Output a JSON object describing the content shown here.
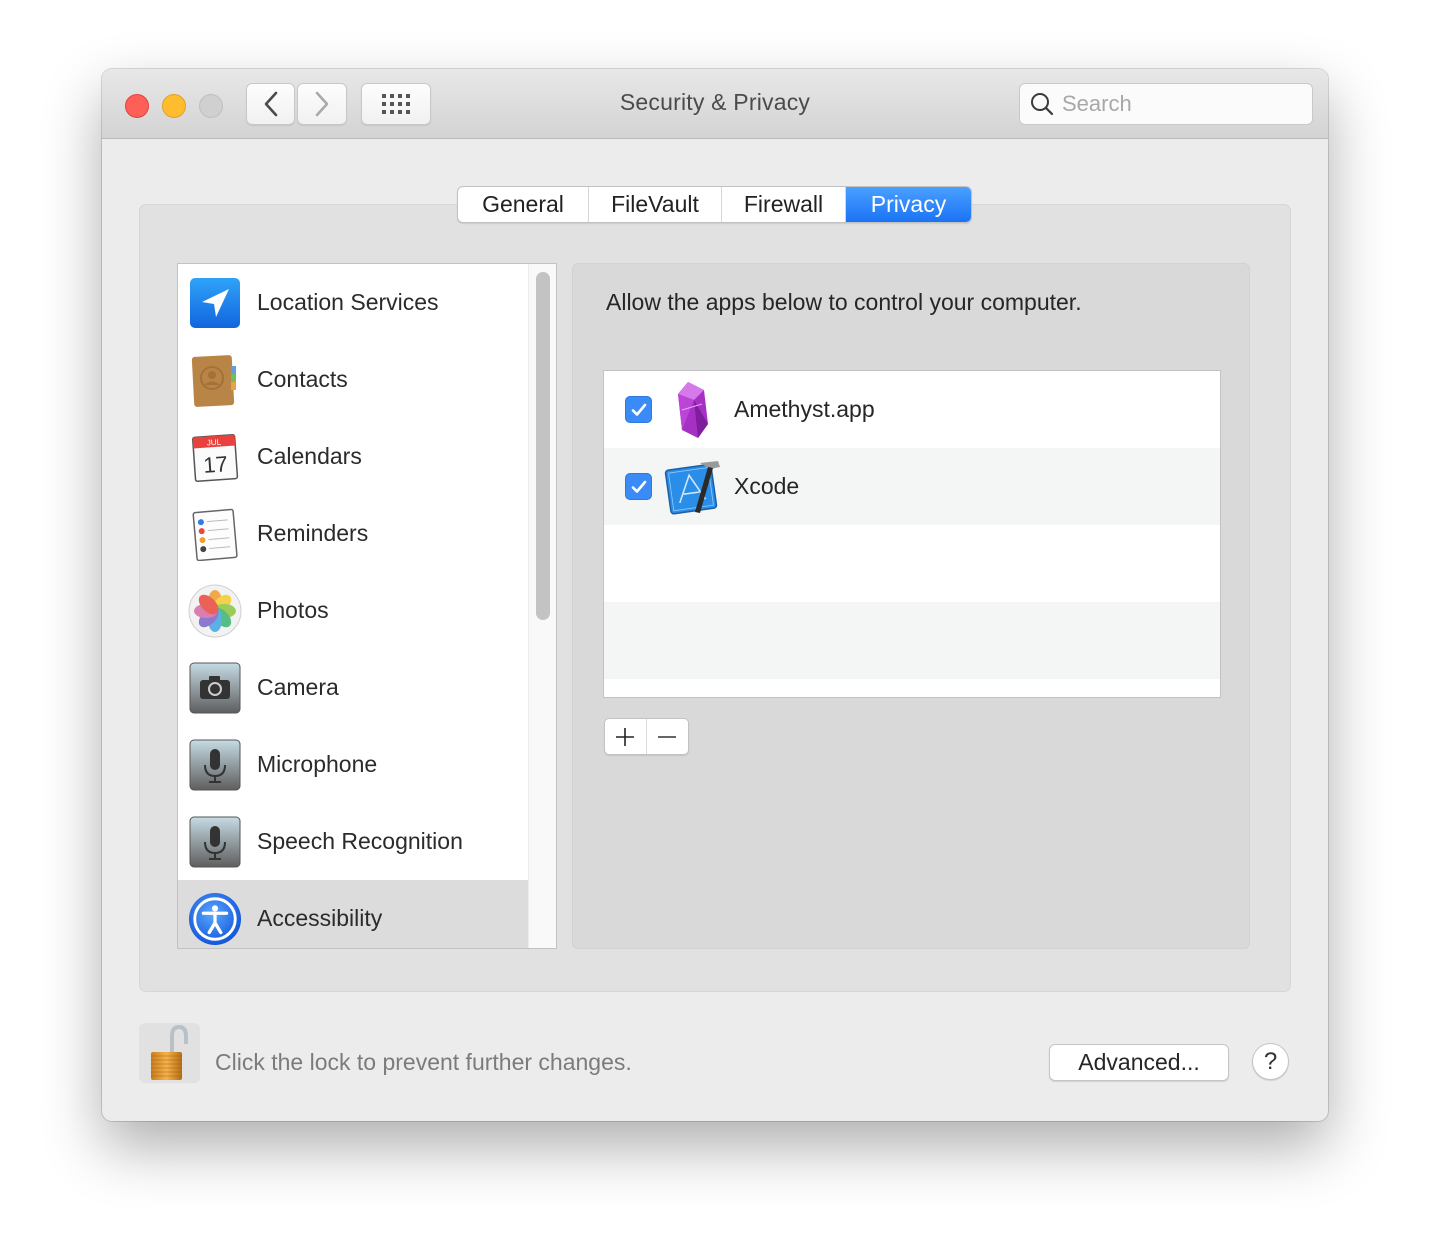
{
  "window": {
    "title": "Security & Privacy",
    "traffic_lights": [
      "close",
      "minimize",
      "zoom"
    ]
  },
  "toolbar": {
    "back_icon": "chevron-left-icon",
    "forward_icon": "chevron-right-icon",
    "show_all_icon": "grid-icon",
    "search": {
      "placeholder": "Search",
      "value": ""
    }
  },
  "tabs": [
    {
      "label": "General",
      "active": false
    },
    {
      "label": "FileVault",
      "active": false
    },
    {
      "label": "Firewall",
      "active": false
    },
    {
      "label": "Privacy",
      "active": true
    }
  ],
  "sidebar": {
    "items": [
      {
        "label": "Location Services",
        "icon": "location-arrow-icon",
        "selected": false
      },
      {
        "label": "Contacts",
        "icon": "contacts-book-icon",
        "selected": false
      },
      {
        "label": "Calendars",
        "icon": "calendar-icon",
        "selected": false,
        "icon_month": "JUL",
        "icon_day": "17"
      },
      {
        "label": "Reminders",
        "icon": "reminders-list-icon",
        "selected": false
      },
      {
        "label": "Photos",
        "icon": "photos-flower-icon",
        "selected": false
      },
      {
        "label": "Camera",
        "icon": "camera-icon",
        "selected": false
      },
      {
        "label": "Microphone",
        "icon": "microphone-icon",
        "selected": false
      },
      {
        "label": "Speech Recognition",
        "icon": "microphone-icon",
        "selected": false
      },
      {
        "label": "Accessibility",
        "icon": "accessibility-icon",
        "selected": true
      }
    ]
  },
  "panel": {
    "description": "Allow the apps below to control your computer.",
    "apps": [
      {
        "name": "Amethyst.app",
        "checked": true,
        "icon": "amethyst-crystal-icon"
      },
      {
        "name": "Xcode",
        "checked": true,
        "icon": "xcode-hammer-icon"
      }
    ],
    "add_label": "+",
    "remove_label": "−"
  },
  "footer": {
    "lock_text": "Click the lock to prevent further changes.",
    "lock_state": "unlocked",
    "advanced_label": "Advanced...",
    "help_label": "?"
  },
  "colors": {
    "accent": "#1a73f5",
    "close": "#fe5f57",
    "minimize": "#febc2e",
    "checkbox": "#3a8bf7"
  }
}
